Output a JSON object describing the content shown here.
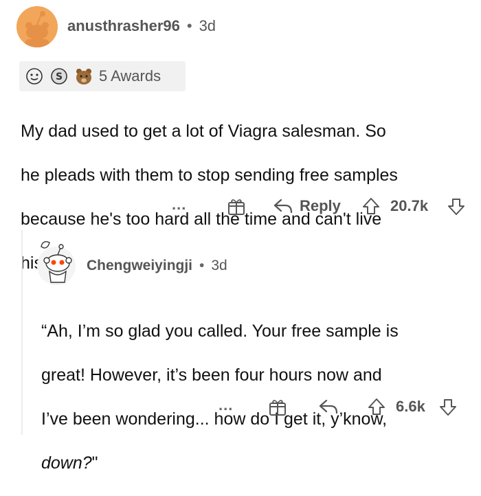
{
  "comment": {
    "username": "anusthrasher96",
    "age": "3d",
    "separator": "•",
    "awards_label": "5 Awards",
    "lines": [
      "My dad used to get a lot of Viagra salesman. So",
      "he pleads with them to stop sending free samples",
      "because he's too hard all the time and can't live",
      "his life."
    ],
    "actions": {
      "more": "...",
      "reply_label": "Reply",
      "score": "20.7k"
    }
  },
  "reply": {
    "username": "Chengweiyingji",
    "age": "3d",
    "separator": "•",
    "lines": [
      "“Ah, I’m so glad you called. Your free sample is",
      "great! However, it’s been four hours now and",
      "I’ve been wondering... how do I get it, y’know,"
    ],
    "last_line_italic": "down?",
    "last_line_tail": "\"",
    "actions": {
      "more": "...",
      "score": "6.6k"
    }
  },
  "colors": {
    "avatar_top": "#f2a65a",
    "text_main": "#111111",
    "text_muted": "#555555",
    "award_bg": "#f1f1f1",
    "thread_line": "#ececec"
  },
  "icons": [
    "snoo-avatar-icon",
    "award-wholesome-icon",
    "award-silver-icon",
    "award-bear-icon",
    "gift-award-icon",
    "reply-arrow-icon",
    "upvote-icon",
    "downvote-icon",
    "snoo-sitting-avatar-icon"
  ]
}
